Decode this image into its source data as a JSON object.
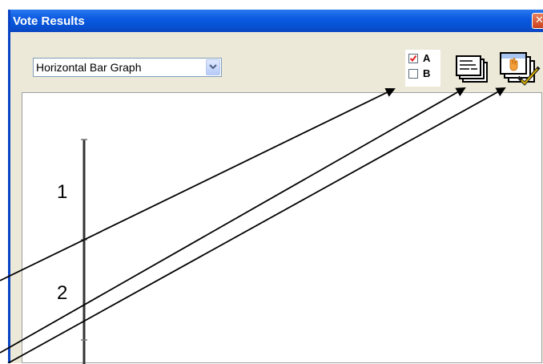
{
  "window": {
    "title": "Vote Results"
  },
  "controls": {
    "graph_type": "Horizontal Bar Graph",
    "toggle_a_label": "A",
    "toggle_b_label": "B",
    "toggle_a_checked": true,
    "toggle_b_checked": false
  },
  "chart_data": {
    "type": "bar",
    "orientation": "horizontal",
    "categories": [
      "1",
      "2"
    ],
    "values": [],
    "title": "",
    "xlabel": "",
    "ylabel": ""
  },
  "icons": {
    "close": "close-icon",
    "dropdown": "chevron-down-icon",
    "checkbox_a": "checkbox-checked-icon",
    "checkbox_b": "checkbox-unchecked-icon",
    "list": "stacked-list-icon",
    "hand": "raise-hand-icon"
  },
  "colors": {
    "titlebar": "#0653d6",
    "window_bg": "#ece9d8",
    "close": "#c9401c",
    "check": "#e02020"
  }
}
